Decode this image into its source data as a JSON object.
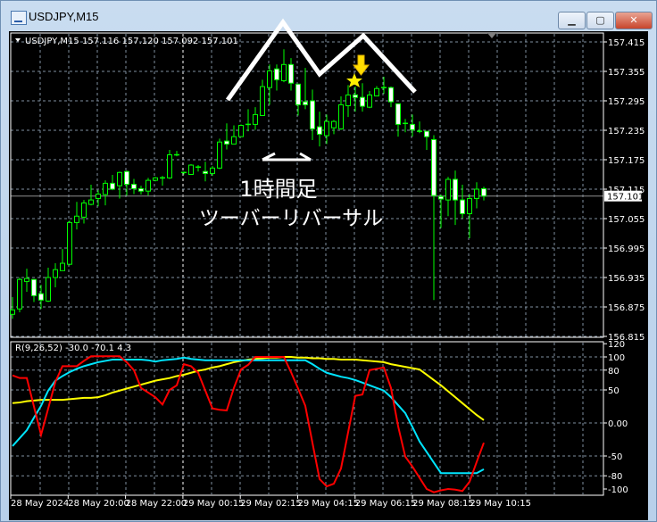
{
  "window": {
    "title": "USDJPY,M15",
    "buttons": {
      "minimize": "▁",
      "maximize": "▢",
      "close": "✕"
    }
  },
  "colors": {
    "background": "#000000",
    "candle_outline": "#00ff00",
    "bear_fill": "#ffffff",
    "bull_fill": "#000000",
    "grid": "#8090a0",
    "red_line": "#ff0000",
    "cyan_line": "#00e5ff",
    "yellow_line": "#ffff00",
    "annotation": "#ffffff",
    "marker": "#ffee00"
  },
  "chart_data": [
    {
      "type": "candlestick",
      "header": "USDJPY,M15  157.116 157.120 157.092 157.101",
      "symbol": "USDJPY,M15",
      "price_ticks": [
        "157.415",
        "157.355",
        "157.295",
        "157.235",
        "157.175",
        "157.115",
        "157.055",
        "156.995",
        "156.935",
        "156.875",
        "156.815"
      ],
      "ylim": [
        156.815,
        157.415
      ],
      "current_price": "157.101",
      "grid": true,
      "time_labels": [
        "28 May 2024",
        "28 May 20:00",
        "28 May 22:00",
        "29 May 00:15",
        "29 May 02:15",
        "29 May 04:15",
        "29 May 06:15",
        "29 May 08:15",
        "29 May 10:15"
      ],
      "ohlc": [
        [
          156.86,
          156.895,
          156.851,
          156.869
        ],
        [
          156.871,
          156.935,
          156.864,
          156.931
        ],
        [
          156.927,
          156.953,
          156.906,
          156.933
        ],
        [
          156.931,
          156.931,
          156.885,
          156.898
        ],
        [
          156.902,
          156.92,
          156.871,
          156.889
        ],
        [
          156.887,
          156.955,
          156.885,
          156.935
        ],
        [
          156.935,
          156.964,
          156.915,
          156.951
        ],
        [
          156.949,
          156.993,
          156.949,
          156.964
        ],
        [
          156.962,
          157.051,
          156.96,
          157.047
        ],
        [
          157.047,
          157.089,
          157.033,
          157.06
        ],
        [
          157.058,
          157.093,
          157.045,
          157.087
        ],
        [
          157.084,
          157.124,
          157.082,
          157.093
        ],
        [
          157.096,
          157.113,
          157.08,
          157.105
        ],
        [
          157.104,
          157.133,
          157.082,
          157.127
        ],
        [
          157.127,
          157.144,
          157.113,
          157.115
        ],
        [
          157.122,
          157.151,
          157.096,
          157.149
        ],
        [
          157.151,
          157.153,
          157.102,
          157.125
        ],
        [
          157.125,
          157.136,
          157.105,
          157.116
        ],
        [
          157.116,
          157.122,
          157.104,
          157.111
        ],
        [
          157.111,
          157.138,
          157.102,
          157.133
        ],
        [
          157.133,
          157.14,
          157.131,
          157.138
        ],
        [
          157.138,
          157.142,
          157.122,
          157.136
        ],
        [
          157.138,
          157.195,
          157.136,
          157.185
        ],
        [
          157.184,
          157.193,
          157.182,
          157.185
        ],
        [
          157.147,
          157.151,
          157.145,
          157.149
        ],
        [
          157.145,
          157.166,
          157.144,
          157.164
        ],
        [
          157.16,
          157.164,
          157.151,
          157.158
        ],
        [
          157.151,
          157.171,
          157.131,
          157.147
        ],
        [
          157.147,
          157.162,
          157.142,
          157.158
        ],
        [
          157.158,
          157.218,
          157.156,
          157.211
        ],
        [
          157.213,
          157.249,
          157.196,
          157.207
        ],
        [
          157.207,
          157.245,
          157.207,
          157.222
        ],
        [
          157.222,
          157.247,
          157.222,
          157.245
        ],
        [
          157.245,
          157.278,
          157.233,
          157.247
        ],
        [
          157.247,
          157.282,
          157.236,
          157.267
        ],
        [
          157.265,
          157.338,
          157.264,
          157.324
        ],
        [
          157.322,
          157.369,
          157.287,
          157.356
        ],
        [
          157.36,
          157.369,
          157.316,
          157.338
        ],
        [
          157.336,
          157.4,
          157.333,
          157.369
        ],
        [
          157.369,
          157.382,
          157.316,
          157.331
        ],
        [
          157.329,
          157.329,
          157.265,
          157.287
        ],
        [
          157.293,
          157.362,
          157.278,
          157.287
        ],
        [
          157.295,
          157.318,
          157.215,
          157.238
        ],
        [
          157.242,
          157.273,
          157.202,
          157.227
        ],
        [
          157.224,
          157.267,
          157.207,
          157.253
        ],
        [
          157.24,
          157.256,
          157.227,
          157.253
        ],
        [
          157.238,
          157.304,
          157.236,
          157.287
        ],
        [
          157.285,
          157.327,
          157.262,
          157.307
        ],
        [
          157.307,
          157.324,
          157.273,
          157.302
        ],
        [
          157.302,
          157.331,
          157.273,
          157.284
        ],
        [
          157.282,
          157.315,
          157.28,
          157.307
        ],
        [
          157.305,
          157.325,
          157.304,
          157.32
        ],
        [
          157.32,
          157.344,
          157.309,
          157.322
        ],
        [
          157.322,
          157.324,
          157.282,
          157.293
        ],
        [
          157.289,
          157.289,
          157.222,
          157.247
        ],
        [
          157.249,
          157.258,
          157.231,
          157.249
        ],
        [
          157.247,
          157.267,
          157.222,
          157.236
        ],
        [
          157.233,
          157.253,
          157.229,
          157.233
        ],
        [
          157.233,
          157.233,
          157.195,
          157.222
        ],
        [
          157.216,
          157.225,
          156.889,
          157.102
        ],
        [
          157.1,
          157.104,
          157.036,
          157.095
        ],
        [
          157.093,
          157.14,
          157.06,
          157.135
        ],
        [
          157.135,
          157.153,
          157.042,
          157.093
        ],
        [
          157.093,
          157.124,
          157.056,
          157.065
        ],
        [
          157.065,
          157.105,
          157.015,
          157.096
        ],
        [
          157.096,
          157.129,
          157.076,
          157.115
        ],
        [
          157.116,
          157.12,
          157.092,
          157.101
        ]
      ],
      "annotations": {
        "zigzag_pattern": "M-shape",
        "label_line1": "1時間足",
        "label_line2": "ツーバーリバーサル",
        "marker": "star",
        "arrow": "down-arrow"
      }
    },
    {
      "type": "line",
      "header": "R(9,26,52) -30.0 -70.1 4.3",
      "ylim": [
        -100,
        120
      ],
      "y_ticks": [
        "120",
        "100",
        "80",
        "50",
        "0.00",
        "-50",
        "-80",
        "-100"
      ],
      "grid": true,
      "series": [
        {
          "color": "#ff0000",
          "values": [
            72,
            68,
            68,
            25,
            -18,
            22,
            62,
            86,
            86,
            86,
            94,
            101,
            101,
            101,
            101,
            101,
            92,
            80,
            53,
            46,
            39,
            28,
            50,
            57,
            89,
            86,
            76,
            49,
            22,
            20,
            19,
            53,
            81,
            88,
            100,
            100,
            100,
            100,
            100,
            77,
            52,
            26,
            -30,
            -85,
            -96,
            -92,
            -69,
            -14,
            41,
            43,
            80,
            82,
            84,
            53,
            -5,
            -51,
            -66,
            -83,
            -100,
            -105,
            -102,
            -100,
            -101,
            -103,
            -89,
            -59,
            -30.0
          ]
        },
        {
          "color": "#00e5ff",
          "values": [
            -35,
            -23,
            -11,
            8,
            26,
            49,
            64,
            71,
            77,
            82,
            86,
            89,
            92,
            94,
            96,
            96,
            96,
            96,
            96,
            95,
            93,
            95,
            96,
            97,
            99,
            97,
            96,
            95,
            95,
            95,
            95,
            95,
            95,
            95,
            95,
            95,
            95,
            95,
            95,
            95,
            95,
            95,
            89,
            82,
            76,
            73,
            70,
            68,
            65,
            61,
            57,
            53,
            49,
            39,
            27,
            15,
            -6,
            -28,
            -44,
            -60,
            -76,
            -76,
            -76,
            -76,
            -76,
            -76,
            -70.1
          ]
        },
        {
          "color": "#ffff00",
          "values": [
            30,
            31,
            33,
            34,
            35,
            35,
            35,
            35,
            36,
            37,
            38,
            38,
            39,
            42,
            46,
            49,
            52,
            55,
            58,
            61,
            64,
            66,
            68,
            71,
            73,
            76,
            79,
            81,
            84,
            86,
            89,
            92,
            94,
            96,
            97,
            98,
            99,
            99,
            100,
            100,
            99,
            99,
            98,
            98,
            97,
            97,
            96,
            96,
            96,
            95,
            94,
            93,
            92,
            89,
            87,
            85,
            83,
            81,
            73,
            65,
            57,
            48,
            39,
            30,
            21,
            12,
            4.3
          ]
        }
      ]
    }
  ]
}
